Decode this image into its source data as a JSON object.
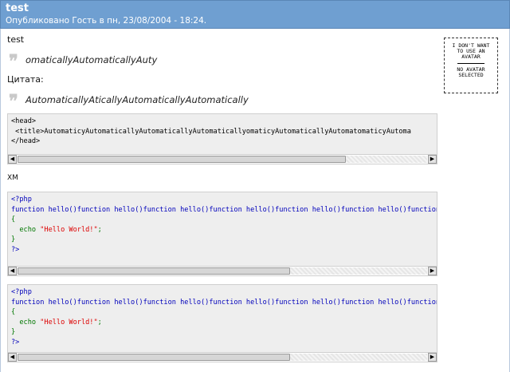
{
  "post": {
    "title": "test",
    "meta": "Опубликовано Гость в пн, 23/08/2004 - 18:24."
  },
  "content": {
    "line1": "test",
    "quote1": "omaticallyAutomaticallyAuty",
    "quote_label": "Цитата:",
    "quote2": "AutomaticallyAticallyAutomaticallyAutomatically",
    "xml_label": "XM"
  },
  "html_code": {
    "lines": [
      "<head>",
      " <title>AutomaticyAutomaticallyAutomaticallyAutomaticallyomaticyAutomaticallyAutomatomaticyAutoma",
      "</head>"
    ]
  },
  "php_block1": {
    "open": "<?php",
    "func_line": "function hello()function hello()function hello()function hello()function hello()function hello()function hello()",
    "brace_open": "{",
    "echo_kw": "  echo ",
    "echo_str": "\"Hello World!\"",
    "echo_end": ";",
    "brace_close": "}",
    "close": "?>"
  },
  "php_block2": {
    "open": "<?php",
    "func_line": "function hello()function hello()function hello()function hello()function hello()function hello()function hello()",
    "brace_open": "{",
    "echo_kw": "  echo ",
    "echo_str": "\"Hello World!\"",
    "echo_end": ";",
    "brace_close": "}",
    "close": "?>"
  },
  "avatar": {
    "line1": "I DON'T WANT TO USE AN AVATAR",
    "line2": "NO AVATAR SELECTED"
  },
  "colors": {
    "header": "#6f9fd1",
    "code_bg": "#eeeeee",
    "keyword": "#0000bb",
    "string": "#dd0000",
    "plain": "#007700"
  }
}
